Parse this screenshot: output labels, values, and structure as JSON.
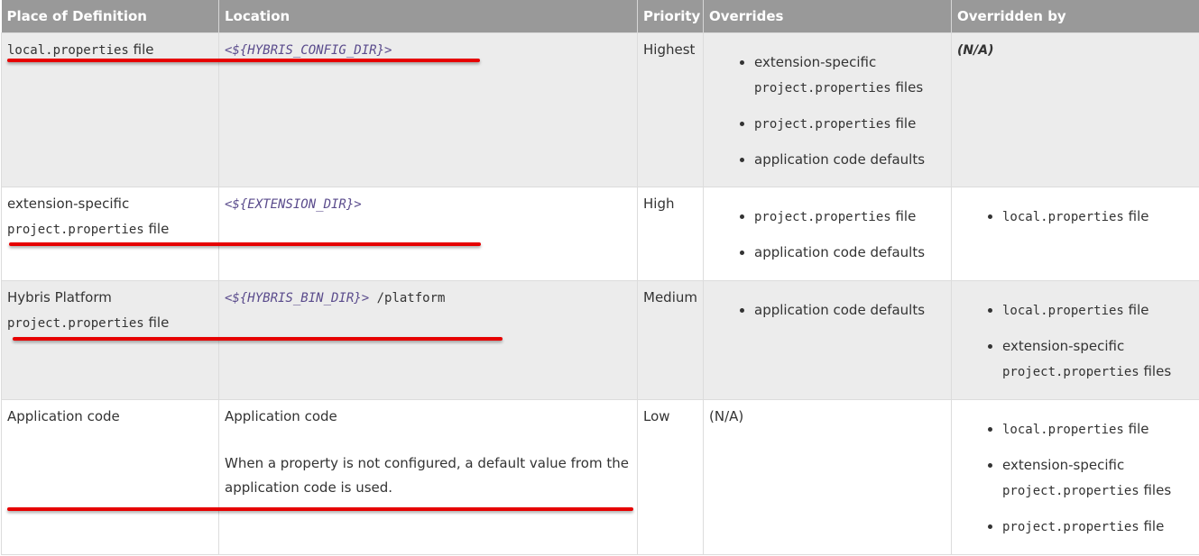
{
  "headers": {
    "place": "Place of Definition",
    "location": "Location",
    "priority": "Priority",
    "overrides": "Overrides",
    "overridden_by": "Overridden by"
  },
  "rows": [
    {
      "place_code": "local.properties",
      "place_suffix": " file",
      "location_var": "<${HYBRIS_CONFIG_DIR}>",
      "priority": "Highest",
      "overrides": {
        "item1_text": "extension-specific",
        "item1_code": "project.properties",
        "item1_suffix": " files",
        "item2_code": "project.properties",
        "item2_suffix": " file",
        "item3_text": "application code defaults"
      },
      "overridden_by": "(N/A)"
    },
    {
      "place_text": "extension-specific",
      "place_code": "project.properties",
      "place_suffix": " file",
      "location_var": "<${EXTENSION_DIR}>",
      "priority": "High",
      "overrides": {
        "item1_code": "project.properties",
        "item1_suffix": " file",
        "item2_text": "application code defaults"
      },
      "overridden_by": {
        "item1_code": "local.properties",
        "item1_suffix": " file"
      }
    },
    {
      "place_text": "Hybris Platform",
      "place_code": "project.properties",
      "place_suffix": " file",
      "location_var": "<${HYBRIS_BIN_DIR}>",
      "location_suffix": " /platform",
      "priority": "Medium",
      "overrides": {
        "item1_text": "application code defaults"
      },
      "overridden_by": {
        "item1_code": "local.properties",
        "item1_suffix": " file",
        "item2_text": "extension-specific",
        "item2_code": "project.properties",
        "item2_suffix": " files"
      }
    },
    {
      "place_text": "Application code",
      "location_text": "Application code",
      "location_note": "When a property is not configured, a default value from the application code is used.",
      "priority": "Low",
      "overrides_text": "(N/A)",
      "overridden_by": {
        "item1_code": "local.properties",
        "item1_suffix": " file",
        "item2_text": "extension-specific",
        "item2_code": "project.properties",
        "item2_suffix": " files",
        "item3_code": "project.properties",
        "item3_suffix": " file"
      }
    }
  ],
  "colors": {
    "header_bg": "#999999",
    "row_shade": "#ececec",
    "annotation_red": "#e60000",
    "variable_text": "#5a4b8c"
  }
}
